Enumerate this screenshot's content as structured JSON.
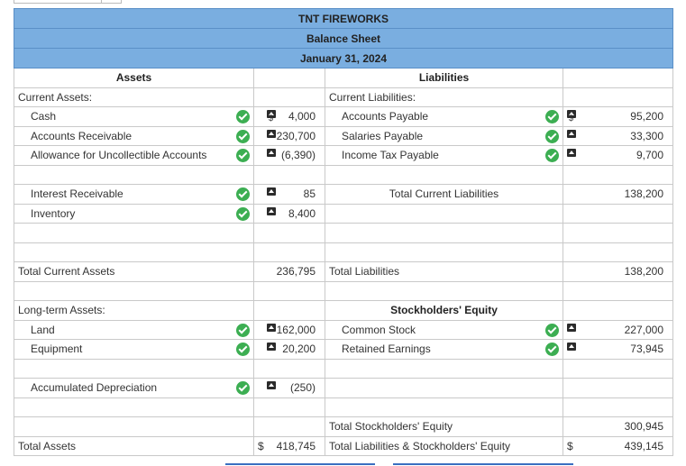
{
  "header": {
    "company": "TNT FIREWORKS",
    "statement": "Balance Sheet",
    "date": "January 31, 2024"
  },
  "columns": {
    "assets": "Assets",
    "liabilities": "Liabilities"
  },
  "left": {
    "current_assets": "Current Assets:",
    "cash": {
      "label": "Cash",
      "value": "4,000"
    },
    "ar": {
      "label": "Accounts Receivable",
      "value": "230,700"
    },
    "allowance": {
      "label": "Allowance for Uncollectible Accounts",
      "value": "(6,390)"
    },
    "interest": {
      "label": "Interest Receivable",
      "value": "85"
    },
    "inventory": {
      "label": "Inventory",
      "value": "8,400"
    },
    "total_current": {
      "label": "Total Current Assets",
      "value": "236,795"
    },
    "long_term": "Long-term Assets:",
    "land": {
      "label": "Land",
      "value": "162,000"
    },
    "equipment": {
      "label": "Equipment",
      "value": "20,200"
    },
    "accum_dep": {
      "label": "Accumulated Depreciation",
      "value": "(250)"
    },
    "total_assets": {
      "label": "Total Assets",
      "currency": "$",
      "value": "418,745"
    }
  },
  "right": {
    "current_liabilities": "Current Liabilities:",
    "ap": {
      "label": "Accounts Payable",
      "value": "95,200"
    },
    "salaries": {
      "label": "Salaries Payable",
      "value": "33,300"
    },
    "income_tax": {
      "label": "Income Tax Payable",
      "value": "9,700"
    },
    "total_current": {
      "label": "Total Current Liabilities",
      "value": "138,200"
    },
    "total_liabilities": {
      "label": "Total Liabilities",
      "value": "138,200"
    },
    "se_header": "Stockholders' Equity",
    "common": {
      "label": "Common Stock",
      "value": "227,000"
    },
    "retained": {
      "label": "Retained Earnings",
      "value": "73,945"
    },
    "total_se": {
      "label": "Total Stockholders' Equity",
      "value": "300,945"
    },
    "total_lse": {
      "label": "Total Liabilities & Stockholders' Equity",
      "currency": "$",
      "value": "439,145"
    }
  },
  "currency_symbol": "$"
}
